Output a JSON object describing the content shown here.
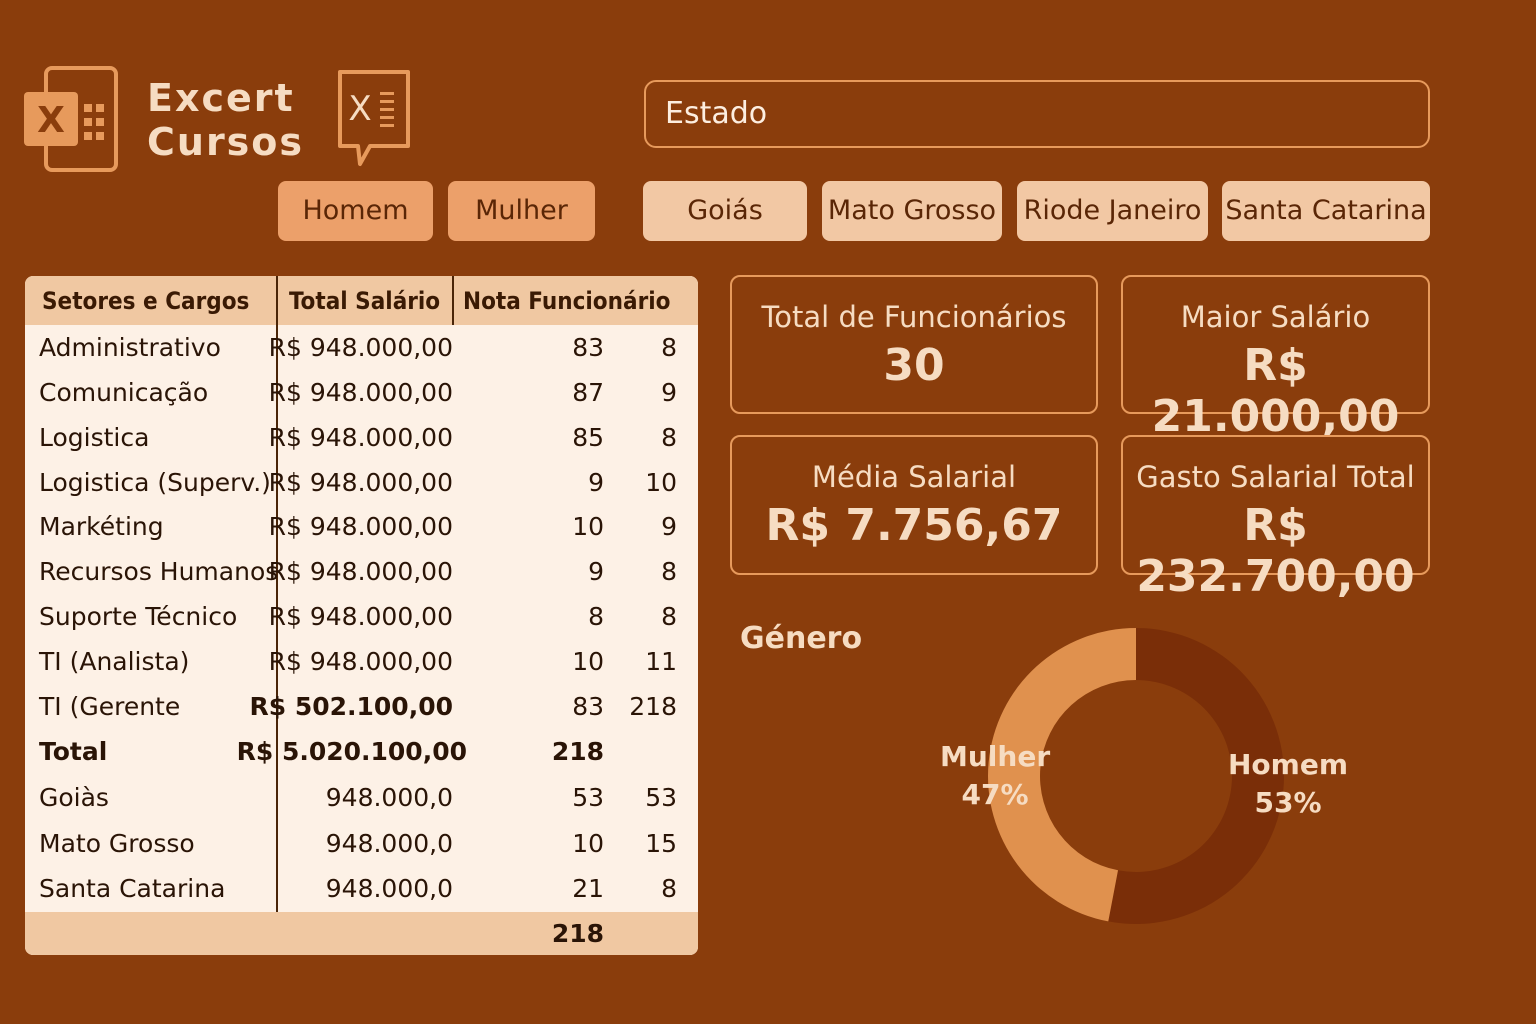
{
  "brand": {
    "line1": "Excert",
    "line2": "Cursos"
  },
  "estado_box": {
    "label": "Estado"
  },
  "gender_slicers": [
    "Homem",
    "Mulher"
  ],
  "state_slicers": [
    "Goiás",
    "Mato Grosso",
    "Riode Janeiro",
    "Santa Catarina"
  ],
  "table": {
    "headers": [
      "Setores e Cargos",
      "Total Salário",
      "Nota Funcionário"
    ],
    "rows": [
      {
        "name": "Administrativo",
        "salary": "R$ 948.000,00",
        "a": "83",
        "b": "8"
      },
      {
        "name": "Comunicação",
        "salary": "R$ 948.000,00",
        "a": "87",
        "b": "9"
      },
      {
        "name": "Logistica",
        "salary": "R$ 948.000,00",
        "a": "85",
        "b": "8"
      },
      {
        "name": "Logistica (Superv.)",
        "salary": "R$ 948.000,00",
        "a": "9",
        "b": "10"
      },
      {
        "name": "Markéting",
        "salary": "R$ 948.000,00",
        "a": "10",
        "b": "9"
      },
      {
        "name": "Recursos Humanos",
        "salary": "R$ 948.000,00",
        "a": "9",
        "b": "8"
      },
      {
        "name": "Suporte Técnico",
        "salary": "R$ 948.000,00",
        "a": "8",
        "b": "8"
      },
      {
        "name": "TI (Analista)",
        "salary": "R$ 948.000,00",
        "a": "10",
        "b": "11"
      },
      {
        "name": "TI (Gerente",
        "salary": "R$ 502.100,00",
        "a": "83",
        "b": "218"
      },
      {
        "name": "Total",
        "salary": "R$ 5.020.100,00",
        "a": "218",
        "b": ""
      },
      {
        "name": "Goiàs",
        "salary": "948.000,0",
        "a": "53",
        "b": "53"
      },
      {
        "name": "Mato Grosso",
        "salary": "948.000,0",
        "a": "10",
        "b": "15"
      },
      {
        "name": "Santa Catarina",
        "salary": "948.000,0",
        "a": "21",
        "b": "8"
      }
    ],
    "footer_total": "218"
  },
  "kpis": {
    "total_funcionarios": {
      "label": "Total de Funcionários",
      "value": "30"
    },
    "maior_salario": {
      "label": "Maior Salário",
      "value": "R$ 21.000,00"
    },
    "media_salarial": {
      "label": "Média Salarial",
      "value": "R$ 7.756,67"
    },
    "gasto_total": {
      "label": "Gasto Salarial Total",
      "value": "R$ 232.700,00"
    }
  },
  "genero": {
    "title": "Género",
    "labels": {
      "mulher": "Mulher",
      "mulher_pct": "47%",
      "homem": "Homem",
      "homem_pct": "53%"
    }
  },
  "chart_data": {
    "type": "pie",
    "title": "Género",
    "categories": [
      "Homem",
      "Mulher"
    ],
    "values": [
      53,
      47
    ],
    "colors": [
      "#7a2e08",
      "#e0914e"
    ]
  },
  "colors": {
    "background": "#8a3d0c",
    "accent": "#e79a5c",
    "table_bg": "#fdf1e6",
    "header_bg": "#f0c8a2"
  }
}
